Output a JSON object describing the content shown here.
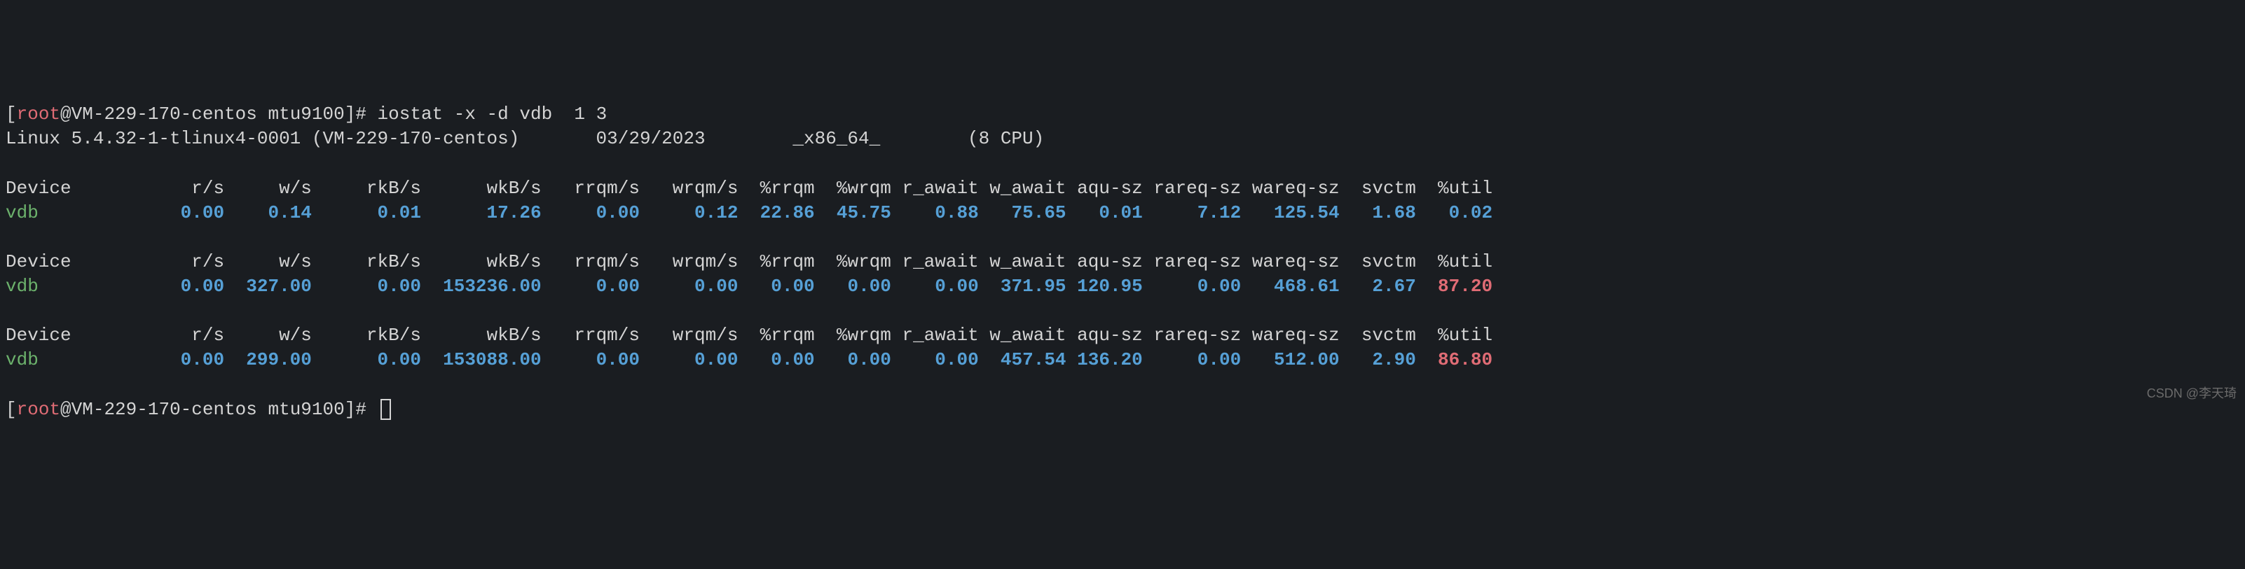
{
  "prompt1": {
    "open": "[",
    "root": "root",
    "at": "@",
    "host": "VM-229-170-centos",
    "dir": " mtu9100",
    "close": "]# ",
    "command": "iostat -x -d vdb  1 3"
  },
  "sysline": {
    "kernel": "Linux 5.4.32-1-tlinux4-0001 (VM-229-170-centos)",
    "date": "03/29/2023",
    "arch": "_x86_64_",
    "cpu": "(8 CPU)"
  },
  "headers": {
    "device": "Device",
    "rs": "r/s",
    "ws": "w/s",
    "rkbs": "rkB/s",
    "wkbs": "wkB/s",
    "rrqms": "rrqm/s",
    "wrqms": "wrqm/s",
    "prrqm": "%rrqm",
    "pwrqm": "%wrqm",
    "rawait": "r_await",
    "wawait": "w_await",
    "aqusz": "aqu-sz",
    "rareqsz": "rareq-sz",
    "wareqsz": "wareq-sz",
    "svctm": "svctm",
    "putil": "%util"
  },
  "samples": [
    {
      "device": "vdb",
      "rs": "0.00",
      "ws": "0.14",
      "rkbs": "0.01",
      "wkbs": "17.26",
      "rrqms": "0.00",
      "wrqms": "0.12",
      "prrqm": "22.86",
      "pwrqm": "45.75",
      "rawait": "0.88",
      "wawait": "75.65",
      "aqusz": "0.01",
      "rareqsz": "7.12",
      "wareqsz": "125.54",
      "svctm": "1.68",
      "putil": "0.02",
      "putil_class": "val-blue"
    },
    {
      "device": "vdb",
      "rs": "0.00",
      "ws": "327.00",
      "rkbs": "0.00",
      "wkbs": "153236.00",
      "rrqms": "0.00",
      "wrqms": "0.00",
      "prrqm": "0.00",
      "pwrqm": "0.00",
      "rawait": "0.00",
      "wawait": "371.95",
      "aqusz": "120.95",
      "rareqsz": "0.00",
      "wareqsz": "468.61",
      "svctm": "2.67",
      "putil": "87.20",
      "putil_class": "val-red"
    },
    {
      "device": "vdb",
      "rs": "0.00",
      "ws": "299.00",
      "rkbs": "0.00",
      "wkbs": "153088.00",
      "rrqms": "0.00",
      "wrqms": "0.00",
      "prrqm": "0.00",
      "pwrqm": "0.00",
      "rawait": "0.00",
      "wawait": "457.54",
      "aqusz": "136.20",
      "rareqsz": "0.00",
      "wareqsz": "512.00",
      "svctm": "2.90",
      "putil": "86.80",
      "putil_class": "val-red"
    }
  ],
  "prompt2": {
    "open": "[",
    "root": "root",
    "at": "@",
    "host": "VM-229-170-centos",
    "dir": " mtu9100",
    "close": "]# "
  },
  "watermark": "CSDN @李天琦"
}
